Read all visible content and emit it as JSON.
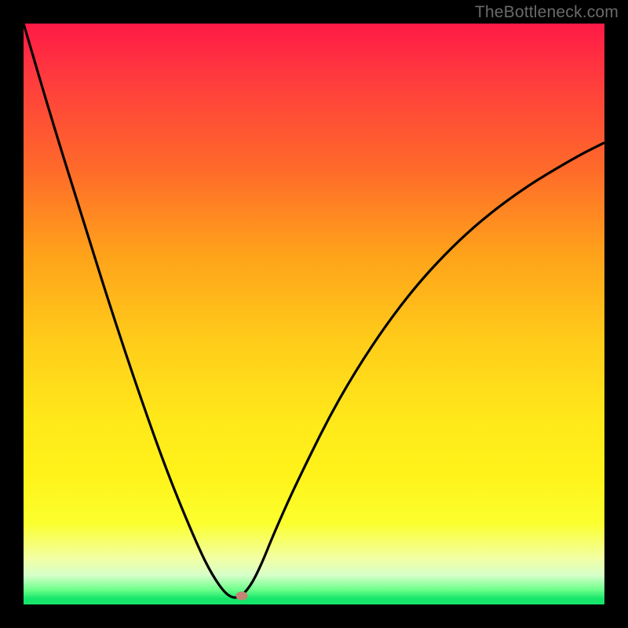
{
  "watermark": "TheBottleneck.com",
  "colors": {
    "background": "#000000",
    "gradient_top": "#ff1a47",
    "gradient_bottom": "#16e66a",
    "curve": "#000000",
    "marker": "#c58474"
  },
  "chart_data": {
    "type": "line",
    "title": "",
    "xlabel": "",
    "ylabel": "",
    "xlim": [
      0,
      100
    ],
    "ylim": [
      0,
      100
    ],
    "grid": false,
    "legend": false,
    "annotations": [
      {
        "type": "watermark",
        "text": "TheBottleneck.com",
        "position": "top-right"
      }
    ],
    "marker": {
      "x_fraction": 0.375,
      "y_fraction": 0.985
    },
    "series": [
      {
        "name": "bottleneck-curve",
        "description": "V-shaped bottleneck curve. y-value is distance-from-top as a fraction of plot height (0 = top red zone, 1 = bottom green baseline). Curve descends steeply from top-left, reaches minimum near x≈0.37, rises back toward upper-right.",
        "x_fraction": [
          0.0,
          0.05,
          0.1,
          0.15,
          0.2,
          0.25,
          0.3,
          0.325,
          0.35,
          0.37,
          0.39,
          0.41,
          0.43,
          0.47,
          0.55,
          0.65,
          0.75,
          0.85,
          0.95,
          1.0
        ],
        "y_from_top_fraction": [
          0.0,
          0.17,
          0.33,
          0.49,
          0.64,
          0.78,
          0.9,
          0.95,
          0.985,
          0.99,
          0.97,
          0.93,
          0.88,
          0.79,
          0.63,
          0.48,
          0.37,
          0.29,
          0.23,
          0.205
        ]
      }
    ]
  }
}
